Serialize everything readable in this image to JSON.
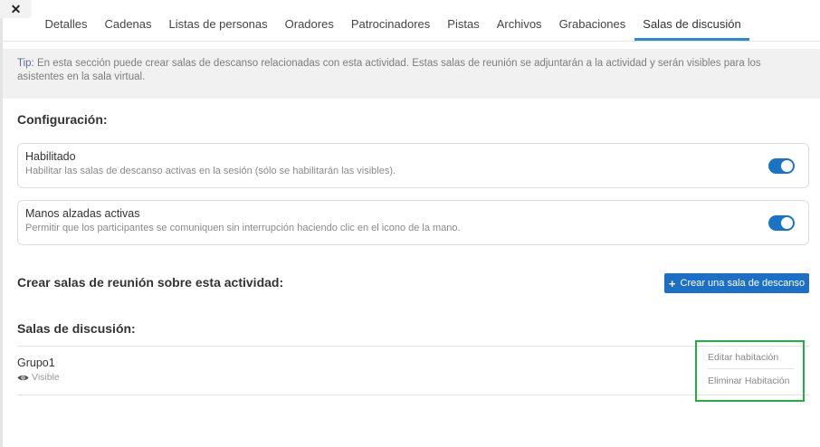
{
  "close": {
    "glyph": "✕"
  },
  "tabs": [
    {
      "label": "Detalles"
    },
    {
      "label": "Cadenas"
    },
    {
      "label": "Listas de personas"
    },
    {
      "label": "Oradores"
    },
    {
      "label": "Patrocinadores"
    },
    {
      "label": "Pistas"
    },
    {
      "label": "Archivos"
    },
    {
      "label": "Grabaciones"
    },
    {
      "label": "Salas de discusión",
      "active": true
    }
  ],
  "tip": {
    "label": "Tip:",
    "text": " En esta sección puede crear salas de descanso relacionadas con esta actividad. Estas salas de reunión se adjuntarán a la actividad y serán visibles para los asistentes en la sala virtual."
  },
  "config": {
    "title": "Configuración:",
    "settings": [
      {
        "title": "Habilitado",
        "description": "Habilitar las salas de descanso activas en la sesión (sólo se habilitarán las visibles).",
        "enabled": true
      },
      {
        "title": "Manos alzadas activas",
        "description": "Permitir que los participantes se comuniquen sin interrupción haciendo clic en el icono de la mano.",
        "enabled": true
      }
    ]
  },
  "create": {
    "title": "Crear salas de reunión sobre esta actividad:",
    "button_icon": "+",
    "button_label": "Crear una sala de descanso"
  },
  "rooms": {
    "title": "Salas de discusión:",
    "items": [
      {
        "name": "Grupo1",
        "status": "Visible",
        "status_icon": "eye-icon"
      }
    ],
    "actions": {
      "edit": "Editar habitación",
      "delete": "Eliminar Habitación"
    }
  },
  "colors": {
    "accent": "#1c6fc4",
    "toggle_on": "#1a74c6",
    "highlight": "#1fb040",
    "tab_underline": "#2b8ad6"
  }
}
